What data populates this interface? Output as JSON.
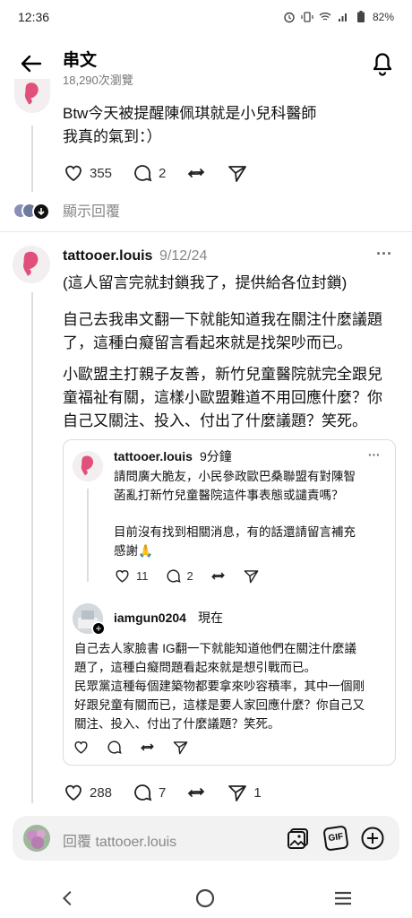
{
  "status_bar": {
    "time": "12:36",
    "battery": "82%"
  },
  "header": {
    "title": "串文",
    "views": "18,290次瀏覽"
  },
  "top_post": {
    "lines": [
      "Btw今天被提醒陳佩琪就是小兒科醫師",
      "我真的氣到：）"
    ],
    "likes": "355",
    "comments": "2",
    "show_replies": "顯示回覆"
  },
  "main_post": {
    "username": "tattooer.louis",
    "date": "9/12/24",
    "more": "···",
    "para1": "(這人留言完就封鎖我了，提供給各位封鎖)",
    "para2_lines": [
      "自己去我串文翻一下就能知道我在關注什麼議題",
      "了，這種白癡留言看起來就是找架吵而已。"
    ],
    "para3_lines": [
      "小歐盟主打親子友善，新竹兒童醫院就完全跟兒",
      "童福祉有關，這樣小歐盟難道不用回應什麼？你",
      "自己又關注、投入、付出了什麼議題？笑死。"
    ],
    "likes": "288",
    "comments": "7",
    "shares": "1"
  },
  "quoted_post": {
    "username": "tattooer.louis",
    "time": "9分鐘",
    "more": "···",
    "lines": [
      "請問廣大脆友，小民參政歐巴桑聯盟有對陳智",
      "菡亂打新竹兒童醫院這件事表態或譴責嗎？"
    ],
    "lines2": [
      "目前沒有找到相關消息，有的話還請留言補充",
      "感謝🙏"
    ],
    "likes": "11",
    "comments": "2"
  },
  "reply_post": {
    "username": "iamgun0204",
    "time": "現在",
    "lines": [
      "自己去人家臉書 IG翻一下就能知道他們在關注什麼議",
      "題了，這種白癡問題看起來就是想引戰而已。",
      "民眾黨這種每個建築物都要拿來吵容積率，其中一個剛",
      "好跟兒童有關而已，這樣是要人家回應什麼？你自己又",
      "關注、投入、付出了什麼議題？笑死。"
    ]
  },
  "reply_bar": {
    "placeholder": "回覆 tattooer.louis",
    "gif_label": "GIF"
  },
  "colors": {
    "avatar_pink": "#e0507a",
    "line": "#dddddd"
  }
}
